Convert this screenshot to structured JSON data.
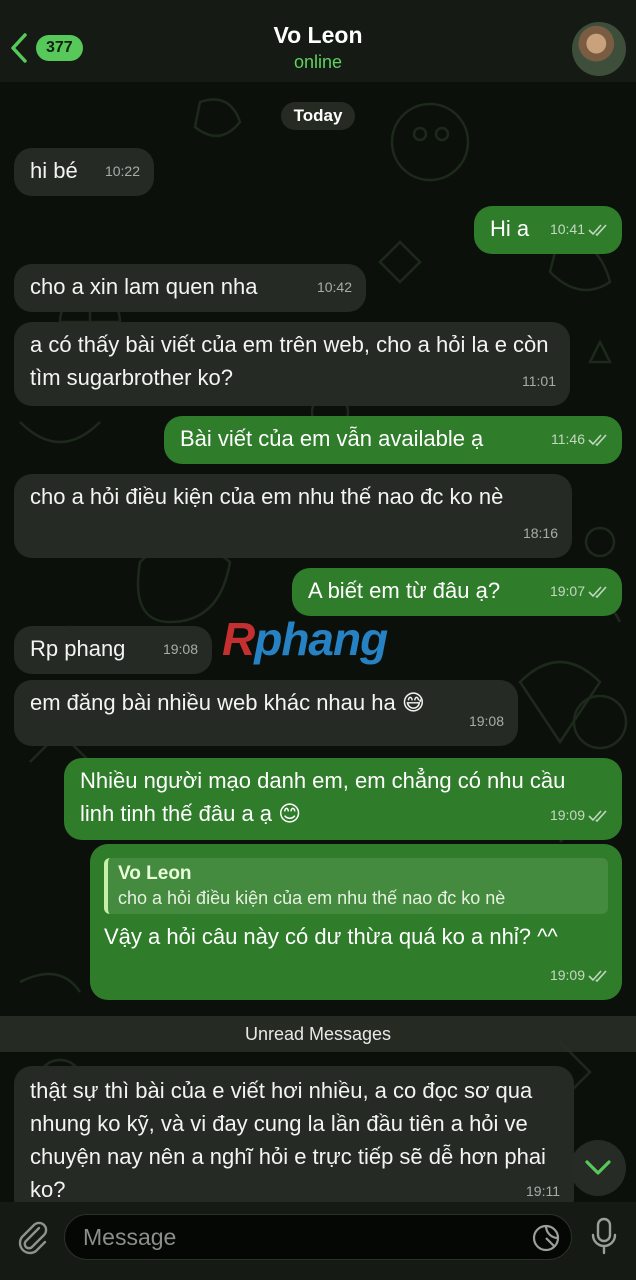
{
  "header": {
    "back_count": "377",
    "title": "Vo Leon",
    "status": "online"
  },
  "date_label": "Today",
  "messages": [
    {
      "text": "hi bé",
      "time": "10:22"
    },
    {
      "text": "Hi a",
      "time": "10:41"
    },
    {
      "text": "cho a xin lam quen nha",
      "time": "10:42"
    },
    {
      "text": "a có thấy bài viết của em trên web, cho a hỏi la e còn tìm sugarbrother ko?",
      "time": "11:01"
    },
    {
      "text": "Bài viết của em vẫn available ạ",
      "time": "11:46"
    },
    {
      "text": "cho a hỏi điều kiện của em nhu thế nao đc ko nè",
      "time": "18:16"
    },
    {
      "text": "A biết em từ đâu ạ?",
      "time": "19:07"
    },
    {
      "text": "Rp phang",
      "time": "19:08"
    },
    {
      "text": "em đăng bài nhiều web khác nhau ha 😅",
      "time": "19:08"
    },
    {
      "text": "Nhiều người mạo danh em, em chẳng có nhu cầu linh tinh thế đâu a ạ 😊",
      "time": "19:09"
    },
    {
      "text": "Vậy a hỏi câu này có dư thừa quá ko a nhỉ? ^^",
      "time": "19:09",
      "reply_name": "Vo Leon",
      "reply_text": "cho a hỏi điều kiện của em nhu thế nao đc ko nè"
    },
    {
      "text": "thật sự thì bài của e viết hơi nhiều, a co đọc sơ qua nhung ko kỹ, và vi đay cung la lần đầu tiên a hỏi ve chuyện nay nên a nghĩ hỏi e trực tiếp sẽ dễ hơn phai ko?",
      "time": "19:11"
    }
  ],
  "unread_label": "Unread Messages",
  "watermark": {
    "r": "R",
    "rest": "phang"
  },
  "composer": {
    "placeholder": "Message"
  },
  "colors": {
    "incoming": "#252b24",
    "outgoing": "#2f7d2a",
    "accent": "#57c95a"
  }
}
